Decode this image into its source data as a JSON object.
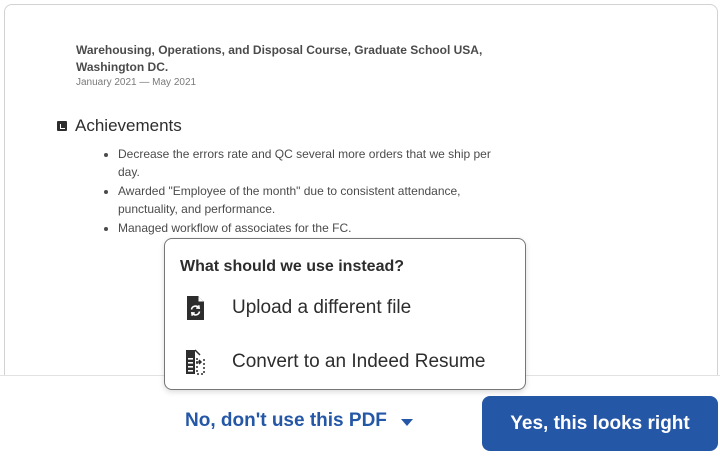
{
  "resume": {
    "education_title": "Warehousing, Operations, and Disposal Course, Graduate School USA, Washington DC.",
    "education_dates": "January 2021 — May 2021",
    "section_title": "Achievements",
    "achievements": [
      "Decrease the errors rate and QC several more orders that we ship per day.",
      "Awarded \"Employee of the month\" due to consistent attendance, punctuality, and performance.",
      "Managed workflow of associates for the FC."
    ]
  },
  "menu": {
    "heading": "What should we use instead?",
    "items": [
      {
        "label": "Upload a different file",
        "icon": "upload-file-icon"
      },
      {
        "label": "Convert to an Indeed Resume",
        "icon": "convert-resume-icon"
      }
    ]
  },
  "actions": {
    "reject_label": "No, don't use this PDF",
    "confirm_label": "Yes, this looks right"
  },
  "colors": {
    "primary": "#2557a7",
    "text": "#2d2d2d"
  }
}
